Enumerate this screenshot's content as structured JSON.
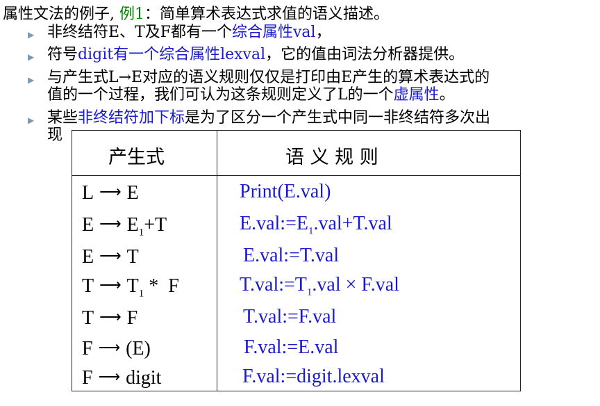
{
  "title": {
    "prefix": "属性文法的例子,",
    "example": "例1",
    "suffix": "：简单算术表达式求值的语义描述。"
  },
  "bullets": [
    {
      "parts": [
        "非终结符E、T及F都有一个",
        "综合属性val",
        "，"
      ]
    },
    {
      "parts": [
        "符号",
        "digit有一个综合属性lexval",
        "，它的值由词法分析器提供。"
      ]
    },
    {
      "line1": "与产生式L→E对应的语义规则仅仅是打印由E产生的算术表达式的",
      "line2": [
        "值的一个过程，我们可认为这条规则定义了L的一个",
        "虚属性",
        "。"
      ]
    },
    {
      "parts": [
        "某些",
        "非终结符加下标",
        "是为了区分一个产生式中同一非终结符多次出"
      ],
      "cont": "现"
    }
  ],
  "table": {
    "col1_header": "产生式",
    "col2_header": "语 义 规 则",
    "rows": [
      {
        "lhs": "L",
        "rhs": "E",
        "rhs_sub": "",
        "rhs_rest": "",
        "rule": "Print(E.val)",
        "rule_sub": "",
        "rule_rest": ""
      },
      {
        "lhs": "E",
        "rhs": "E",
        "rhs_sub": "1",
        "rhs_rest": "+T",
        "rule": "E.val:=E",
        "rule_sub": "1",
        "rule_rest": ".val+T.val"
      },
      {
        "lhs": "E",
        "rhs": "T",
        "rhs_sub": "",
        "rhs_rest": "",
        "rule": "E.val:=T.val",
        "rule_sub": "",
        "rule_rest": ""
      },
      {
        "lhs": "T",
        "rhs": "T",
        "rhs_sub": "1",
        "rhs_rest": " *  F",
        "rule": "T.val:=T",
        "rule_sub": "1",
        "rule_rest": ".val × F.val"
      },
      {
        "lhs": "T",
        "rhs": "F",
        "rhs_sub": "",
        "rhs_rest": "",
        "rule": "T.val:=F.val",
        "rule_sub": "",
        "rule_rest": ""
      },
      {
        "lhs": "F",
        "rhs": "(E)",
        "rhs_sub": "",
        "rhs_rest": "",
        "rule": "F.val:=E.val",
        "rule_sub": "",
        "rule_rest": ""
      },
      {
        "lhs": "F",
        "rhs": "digit",
        "rhs_sub": "",
        "rhs_rest": "",
        "rule": "F.val:=digit.lexval",
        "rule_sub": "",
        "rule_rest": ""
      }
    ],
    "arrow": "⟶"
  },
  "colors": {
    "accent_green": "#008000",
    "accent_blue": "#1a1acc",
    "bullet": "#7a9ab8"
  }
}
